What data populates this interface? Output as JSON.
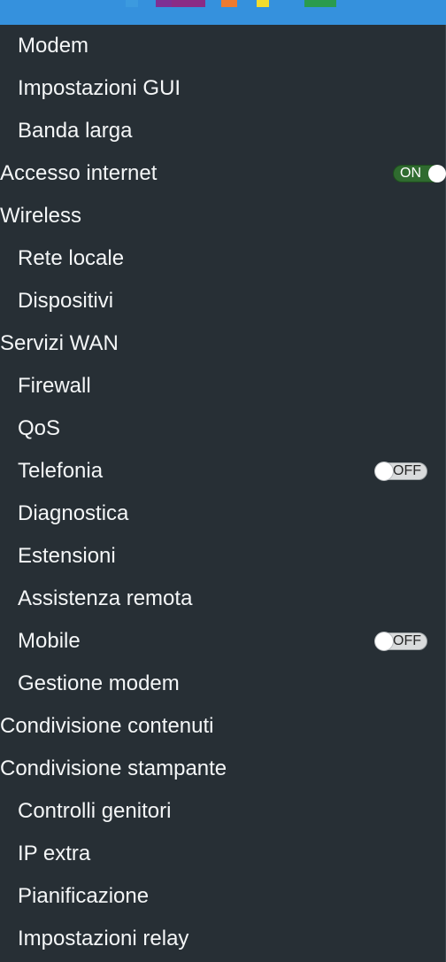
{
  "header": {
    "logo_colors": [
      "#3c9adf",
      "#7e2f94",
      "#8a2c86",
      "#ee7b30",
      "#f4dc2e",
      "#2a9b4e"
    ]
  },
  "menu": {
    "items": [
      {
        "label": "Modem",
        "level": "sub"
      },
      {
        "label": "Impostazioni GUI",
        "level": "sub"
      },
      {
        "label": "Banda larga",
        "level": "sub"
      },
      {
        "label": "Accesso internet",
        "level": "top",
        "toggle": "ON"
      },
      {
        "label": "Wireless",
        "level": "top"
      },
      {
        "label": "Rete locale",
        "level": "sub"
      },
      {
        "label": "Dispositivi",
        "level": "sub"
      },
      {
        "label": "Servizi WAN",
        "level": "top"
      },
      {
        "label": "Firewall",
        "level": "sub"
      },
      {
        "label": "QoS",
        "level": "sub"
      },
      {
        "label": "Telefonia",
        "level": "sub",
        "toggle": "OFF"
      },
      {
        "label": "Diagnostica",
        "level": "sub"
      },
      {
        "label": "Estensioni",
        "level": "sub"
      },
      {
        "label": "Assistenza remota",
        "level": "sub"
      },
      {
        "label": "Mobile",
        "level": "sub",
        "toggle": "OFF"
      },
      {
        "label": "Gestione modem",
        "level": "sub"
      },
      {
        "label": "Condivisione contenuti",
        "level": "top"
      },
      {
        "label": "Condivisione stampante",
        "level": "top"
      },
      {
        "label": "Controlli genitori",
        "level": "sub"
      },
      {
        "label": "IP extra",
        "level": "sub"
      },
      {
        "label": "Pianificazione",
        "level": "sub"
      },
      {
        "label": "Impostazioni relay",
        "level": "sub"
      }
    ]
  }
}
